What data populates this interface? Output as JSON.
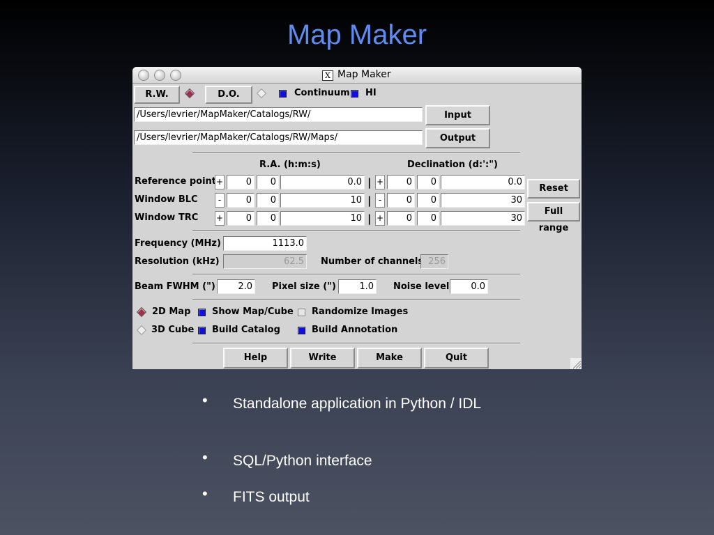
{
  "slide": {
    "title": "Map Maker",
    "bullets": [
      "Standalone application in Python / IDL",
      "SQL/Python interface",
      "FITS output"
    ]
  },
  "window": {
    "title": "Map Maker",
    "titlebar_icon": "X",
    "toolbar": {
      "rw_label": "R.W.",
      "do_label": "D.O.",
      "rw_selected": true,
      "do_selected": false,
      "continuum_label": "Continuum",
      "continuum_checked": true,
      "hi_label": "HI",
      "hi_checked": true
    },
    "paths": {
      "input_path": "/Users/levrier/MapMaker/Catalogs/RW/",
      "output_path": "/Users/levrier/MapMaker/Catalogs/RW/Maps/",
      "input_button": "Input",
      "output_button": "Output"
    },
    "coords": {
      "ra_header": "R.A. (h:m:s)",
      "dec_header": "Declination (d:':\")",
      "rows": [
        {
          "label": "Reference point",
          "ra_sign": "+",
          "ra_h": "0",
          "ra_m": "0",
          "ra_s": "0.0",
          "dec_sign": "+",
          "dec_d": "0",
          "dec_m": "0",
          "dec_s": "0.0"
        },
        {
          "label": "Window BLC",
          "ra_sign": "-",
          "ra_h": "0",
          "ra_m": "0",
          "ra_s": "10",
          "dec_sign": "-",
          "dec_d": "0",
          "dec_m": "0",
          "dec_s": "30"
        },
        {
          "label": "Window TRC",
          "ra_sign": "+",
          "ra_h": "0",
          "ra_m": "0",
          "ra_s": "10",
          "dec_sign": "+",
          "dec_d": "0",
          "dec_m": "0",
          "dec_s": "30"
        }
      ],
      "separator": "|",
      "reset_button": "Reset",
      "full_range_button": "Full range"
    },
    "spectral": {
      "frequency_label": "Frequency (MHz)",
      "frequency_value": "1113.0",
      "resolution_label": "Resolution (kHz)",
      "resolution_value": "62.5",
      "channels_label": "Number of channels",
      "channels_value": "256"
    },
    "beam": {
      "fwhm_label": "Beam FWHM (\")",
      "fwhm_value": "2.0",
      "pixel_label": "Pixel size (\")",
      "pixel_value": "1.0",
      "noise_label": "Noise level",
      "noise_value": "0.0"
    },
    "options": {
      "map2d_label": "2D Map",
      "map2d_selected": true,
      "cube3d_label": "3D Cube",
      "cube3d_selected": false,
      "show_map_label": "Show Map/Cube",
      "show_map_checked": true,
      "randomize_label": "Randomize Images",
      "randomize_checked": false,
      "build_catalog_label": "Build Catalog",
      "build_catalog_checked": true,
      "build_annotation_label": "Build Annotation",
      "build_annotation_checked": true
    },
    "actions": {
      "help": "Help",
      "write": "Write",
      "make": "Make",
      "quit": "Quit"
    },
    "colors": {
      "check_on": "#1010d8",
      "radio_on": "#a0304a",
      "slide_title": "#5f8cf0"
    }
  }
}
